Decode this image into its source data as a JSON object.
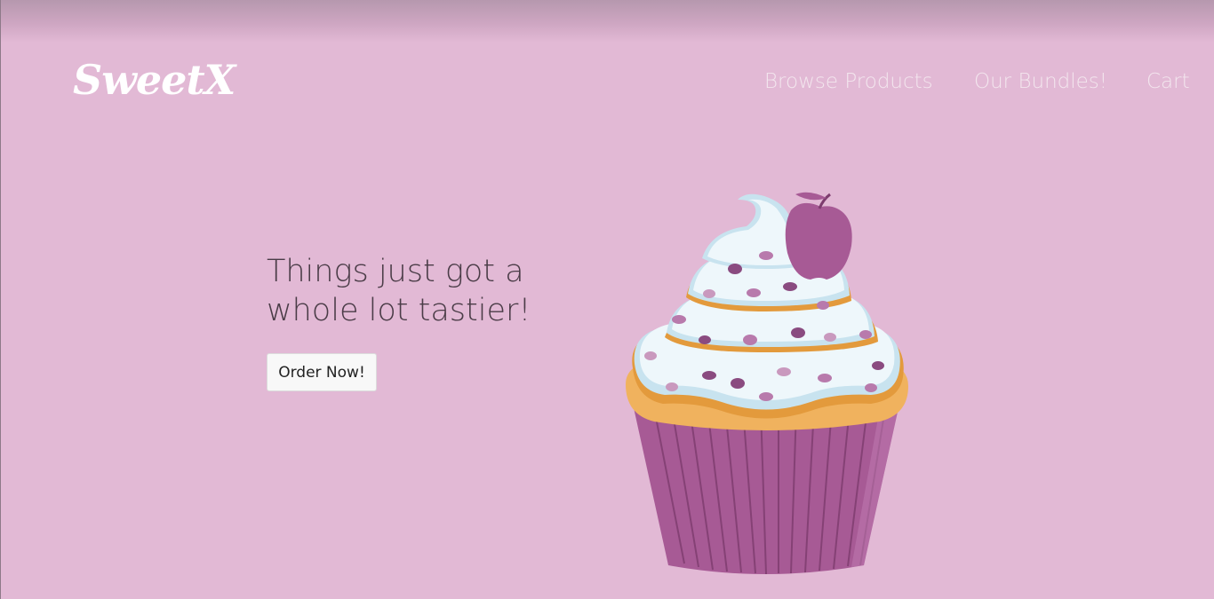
{
  "brand": {
    "logo_text": "SweetX"
  },
  "nav": {
    "browse_label": "Browse Products",
    "bundles_label": "Our Bundles!",
    "cart_label": "Cart"
  },
  "hero": {
    "headline": "Things just got a whole lot tastier!",
    "cta_label": "Order Now!"
  },
  "colors": {
    "background": "#e2b9d5",
    "wrapper": "#a75a95",
    "frosting": "#eef7fb",
    "cake": "#f0b25e",
    "apple": "#a75a95"
  },
  "illustration": {
    "icon": "cupcake-illustration"
  }
}
